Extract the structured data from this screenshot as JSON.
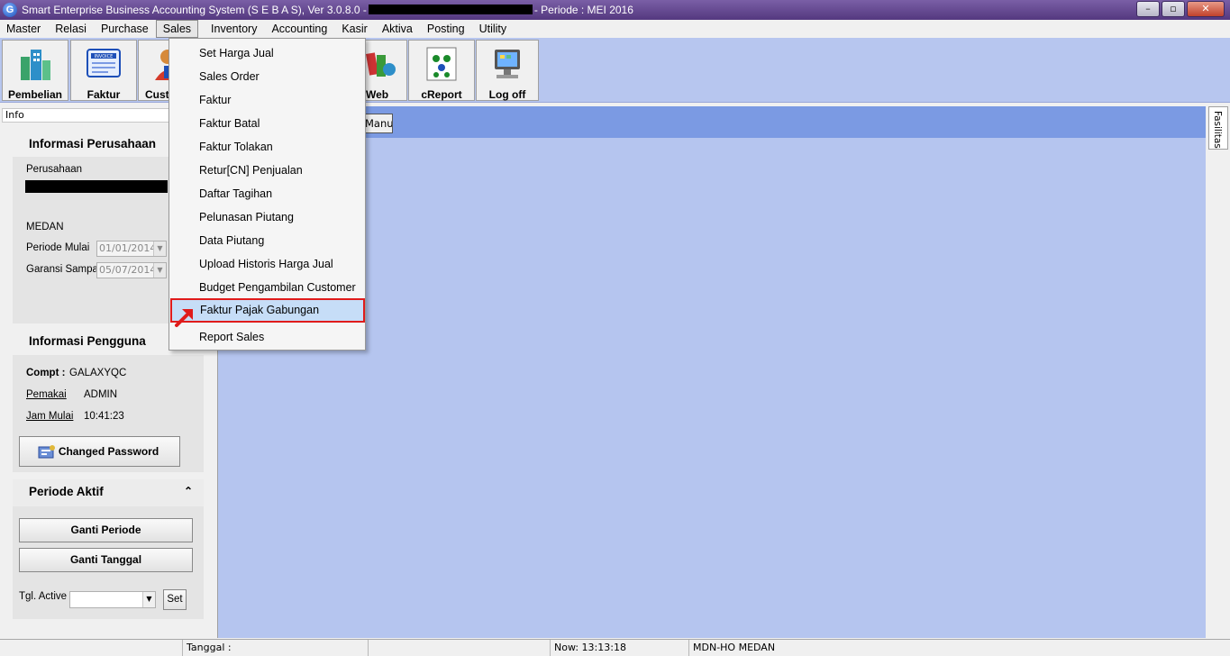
{
  "titlebar": {
    "title_left": "Smart Enterprise Business Accounting System (S E B A S), Ver 3.0.8.0 -",
    "title_right": "- Periode : MEI  2016",
    "app_icon_letter": "G",
    "minimize": "–",
    "maximize": "▫",
    "close": "✕"
  },
  "menubar": {
    "items": [
      "Master",
      "Relasi",
      "Purchase",
      "Sales",
      "Inventory",
      "Accounting",
      "Kasir",
      "Aktiva",
      "Posting",
      "Utility"
    ]
  },
  "toolbar": {
    "buttons": [
      "Pembelian",
      "Faktur",
      "Cust",
      "Web",
      "cReport",
      "Log off"
    ],
    "faktur_icon_text": "INVOICE"
  },
  "info_panel": {
    "tab_label": "Info",
    "company_section": {
      "title": "Informasi Perusahaan",
      "company_label": "Perusahaan",
      "city": "MEDAN",
      "period_start_label": "Periode Mulai",
      "period_start_value": "01/01/2014",
      "warranty_label": "Garansi Sampai",
      "warranty_value": "05/07/2014"
    },
    "user_section": {
      "title": "Informasi Pengguna",
      "compt_label": "Compt :",
      "compt_value": "GALAXYQC",
      "user_label": "Pemakai",
      "user_value": "ADMIN",
      "start_label": "Jam Mulai",
      "start_value": "10:41:23",
      "change_password": "Changed Password"
    },
    "period_section": {
      "title": "Periode Aktif",
      "collapse_glyph": "⌃",
      "change_period": "Ganti Periode",
      "change_date": "Ganti Tanggal",
      "active_date_label": "Tgl. Active",
      "set_label": "Set"
    }
  },
  "main": {
    "manual_button": "Manual",
    "side_tab": "Fasilitas"
  },
  "sales_menu": {
    "items": [
      "Set Harga Jual",
      "Sales Order",
      "Faktur",
      "Faktur Batal",
      "Faktur Tolakan",
      "Retur[CN] Penjualan",
      "Daftar Tagihan",
      "Pelunasan Piutang",
      "Data Piutang",
      "Upload Historis Harga Jual",
      "Budget Pengambilan Customer",
      "Faktur Pajak Gabungan",
      "Report Sales"
    ],
    "highlighted_index": 11
  },
  "statusbar": {
    "tanggal": "Tanggal :",
    "now": "Now: 13:13:18",
    "location": "MDN-HO MEDAN"
  },
  "colors": {
    "title_bar": "#54387f",
    "toolbar_bg": "#b7c6ef",
    "main_bg": "#b5c5ef",
    "main_header": "#7b9ae3",
    "menu_highlight": "#c6ddf7",
    "annotation_red": "#e01b1b"
  }
}
